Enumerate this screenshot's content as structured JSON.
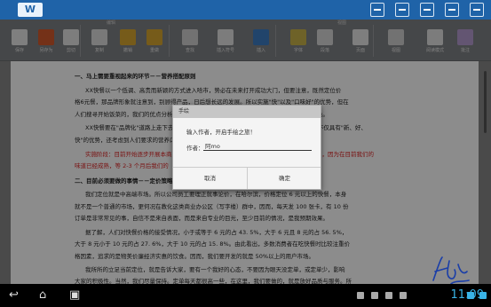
{
  "app": {
    "logo": "W"
  },
  "ribbon": {
    "group1": "编辑",
    "group2": "视图",
    "tools": [
      {
        "label": "保存",
        "icon": "save-icon",
        "color": "#e8e8e8"
      },
      {
        "label": "另存为",
        "icon": "save-as-icon",
        "color": "#d35a2c"
      },
      {
        "label": "剪切",
        "icon": "cut-icon",
        "color": "#e4e4e4"
      },
      {
        "label": "复制",
        "icon": "copy-icon",
        "color": "#dcdcdc"
      },
      {
        "label": "撤销",
        "icon": "undo-icon",
        "color": "#d8a630"
      },
      {
        "label": "重做",
        "icon": "redo-icon",
        "color": "#d8a630"
      },
      {
        "label": "查找",
        "icon": "find-icon",
        "color": "#cfcfcf"
      },
      {
        "label": "插入符号",
        "icon": "symbol-icon",
        "color": "#e2e2e2"
      },
      {
        "label": "插入",
        "icon": "insert-icon",
        "color": "#3c7dc4"
      },
      {
        "label": "字体",
        "icon": "font-icon",
        "color": "#c9b34a"
      },
      {
        "label": "段落",
        "icon": "paragraph-icon",
        "color": "#d8d8d8"
      },
      {
        "label": "页面",
        "icon": "page-icon",
        "color": "#e6e6e6"
      },
      {
        "label": "视图",
        "icon": "view-icon",
        "color": "#d0d0d0"
      },
      {
        "label": "阅读模式",
        "icon": "read-icon",
        "color": "#e2e2e2"
      },
      {
        "label": "批注",
        "icon": "comment-icon",
        "color": "#b59ccf"
      }
    ]
  },
  "document": {
    "lines": [
      {
        "text": "一、马上需要重视起来的环节－－营养搭配原则",
        "style": "h"
      },
      {
        "text": "XX快餐以一个低调、高贵而新颖的方式进入哈市，势必在未来打开成功大门，但要注意，既然定位价",
        "style": ""
      },
      {
        "text": "格6元餐，那品牌形象就注意到，别顾得产品，日后想长远的发展。所以实施\"快\"以及\"口味好\"的优势，但在",
        "style": ""
      },
      {
        "text": "人们搜寻开始饭菜的，我们的优点分析方面，会留对营养方面重视的人生的发展关注度太大的特色。",
        "style": ""
      },
      {
        "text": "XX快餐要在\"品牌化\"道路上走下去，必须从现在开始，我们在本期都可以优惠的服务，我们不仅具有\"新、好、",
        "style": ""
      },
      {
        "text": "快\"的优势，还考虑到人们要求的营养口味……",
        "style": ""
      },
      {
        "text": "实施阶段：目前开始逐步开展本商业区间，每天营养餐的各项安排建议，可以让公司重点推广，因为在目前我们的",
        "style": "red"
      },
      {
        "text": "味道已经成熟，等 2-3 个月后我们的",
        "style": "red"
      },
      {
        "text": "二、目前必须要做的事情－－定价策略",
        "style": "h"
      },
      {
        "text": "我们定位就是中高端市场。所以公司员工要理正就事论价，在哈尔滨，价格定位 6 元以上的快餐，本身",
        "style": ""
      },
      {
        "text": "就不是一个普通的市场，更何况在教化这类商业办公区（写字楼）群中，因而，每天发 100 张卡，有 10 份",
        "style": ""
      },
      {
        "text": "订单是非常常见的事，自信不是来自表面，而是来自专业的目光，至少目前的情况，是我预期效果。",
        "style": ""
      },
      {
        "text": "据了解，人们对快餐价格的接受情况，小于或等于 6 元的占 43. 5%，大于 6 元且 8 元的占 56. 5%，",
        "style": ""
      },
      {
        "text": "大于 8 元小于 10 元的占 27. 6%，大于 10 元的占 15. 8%。由此看出，多数消费者在吃快餐时比较注重价",
        "style": ""
      },
      {
        "text": "格因素，追求的是物美价廉经济实惠的饮食。因而，我们要开发的就是 50%以上的用户市场。",
        "style": ""
      },
      {
        "text": "我所所的立足当前定位，就是告诉大家，要有一个我好的心态，不要因为眼天没定单，或定单少，影响",
        "style": ""
      },
      {
        "text": "大家的积极性。当然，我们尽量保持。定单每天都很高一些，在这里，我们要做的，就是放好品质与服务。所",
        "style": ""
      }
    ]
  },
  "dialog": {
    "title": "手绘",
    "prompt": "输入作者，开启手绘之旅！",
    "author_label": "作者：",
    "author_value": "阿mo",
    "cancel": "取消",
    "ok": "确定"
  },
  "status": {
    "time": "11:09"
  },
  "colors": {
    "topbar": "#1f63a8",
    "accent": "#39b3e6",
    "red_text": "#d22222"
  }
}
